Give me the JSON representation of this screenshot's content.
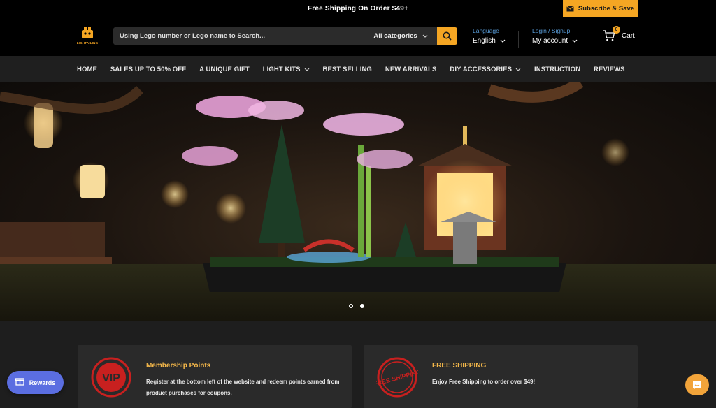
{
  "topbar": {
    "announcement": "Free Shipping On Order $49+",
    "subscribe_label": "Subscribe & Save"
  },
  "header": {
    "logo_text": "LIGHTAILING",
    "search": {
      "placeholder": "Using Lego number or Lego name to Search...",
      "category": "All categories"
    },
    "language": {
      "label": "Language",
      "value": "English"
    },
    "account": {
      "label": "Login / Signup",
      "value": "My account"
    },
    "cart": {
      "label": "Cart",
      "count": "0"
    }
  },
  "nav": {
    "items": [
      {
        "label": "HOME"
      },
      {
        "label": "SALES UP TO 50% OFF"
      },
      {
        "label": "A UNIQUE GIFT"
      },
      {
        "label": "LIGHT KITS"
      },
      {
        "label": "BEST SELLING"
      },
      {
        "label": "NEW ARRIVALS"
      },
      {
        "label": "DIY ACCESSORIES"
      },
      {
        "label": "INSTRUCTION"
      },
      {
        "label": "REVIEWS"
      }
    ]
  },
  "hero": {
    "slide_count": 2,
    "active_slide": 2
  },
  "features": [
    {
      "icon_text": "VIP",
      "title": "Membership Points",
      "desc": "Register at the bottom left of the website and redeem points earned from product purchases for coupons."
    },
    {
      "icon_text": "FREE SHIPPING",
      "title": "FREE SHIPPING",
      "desc": "Enjoy Free Shipping to order over $49!"
    }
  ],
  "floating": {
    "rewards_label": "Rewards"
  },
  "colors": {
    "accent": "#f5a623",
    "link": "#5a9fdc",
    "rewards": "#5b6ee1",
    "stamp_red": "#c8201f"
  },
  "icons": [
    "mail-icon",
    "search-icon",
    "chevron-down-icon",
    "cart-icon",
    "gift-icon",
    "chat-icon"
  ]
}
